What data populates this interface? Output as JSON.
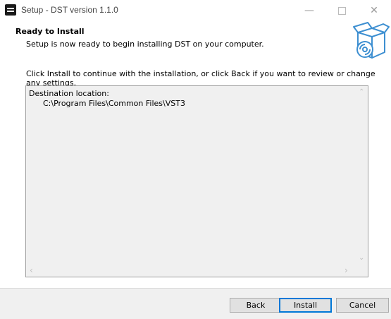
{
  "window": {
    "title": "Setup - DST version 1.1.0",
    "minimize_glyph": "—",
    "close_glyph": "✕"
  },
  "header": {
    "title": "Ready to Install",
    "subtitle": "Setup is now ready to begin installing DST on your computer."
  },
  "instruction": "Click Install to continue with the installation, or click Back if you want to review or change any settings.",
  "memo": {
    "line1": "Destination location:",
    "line2": "C:\\Program Files\\Common Files\\VST3"
  },
  "buttons": {
    "back": "Back",
    "install": "Install",
    "cancel": "Cancel"
  },
  "colors": {
    "accent": "#0078d7",
    "icon_blue": "#3d8fd1"
  }
}
